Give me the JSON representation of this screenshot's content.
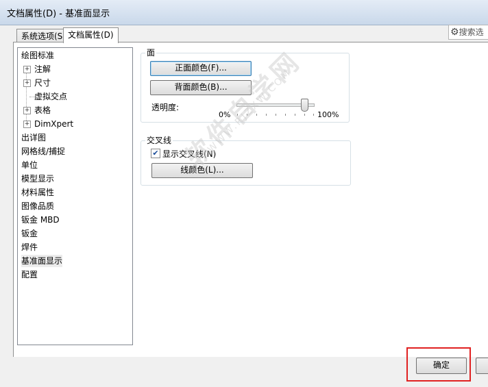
{
  "window": {
    "title": "文档属性(D) - 基准面显示"
  },
  "tabs": [
    {
      "label": "系统选项(S)"
    },
    {
      "label": "文档属性(D)"
    }
  ],
  "search": {
    "placeholder": "搜索选"
  },
  "tree": {
    "items": [
      {
        "label": "绘图标准",
        "expandable": false
      },
      {
        "label": "注解",
        "expandable": true
      },
      {
        "label": "尺寸",
        "expandable": true
      },
      {
        "label": "虚拟交点",
        "expandable": false
      },
      {
        "label": "表格",
        "expandable": true
      },
      {
        "label": "DimXpert",
        "expandable": true
      },
      {
        "label": "出详图",
        "expandable": false
      },
      {
        "label": "网格线/捕捉",
        "expandable": false
      },
      {
        "label": "单位",
        "expandable": false
      },
      {
        "label": "模型显示",
        "expandable": false
      },
      {
        "label": "材料属性",
        "expandable": false
      },
      {
        "label": "图像品质",
        "expandable": false
      },
      {
        "label": "钣金 MBD",
        "expandable": false
      },
      {
        "label": "钣金",
        "expandable": false
      },
      {
        "label": "焊件",
        "expandable": false
      },
      {
        "label": "基准面显示",
        "expandable": false,
        "selected": true
      },
      {
        "label": "配置",
        "expandable": false
      }
    ]
  },
  "face_group": {
    "legend": "面",
    "front_color_button": "正面颜色(F)...",
    "back_color_button": "背面颜色(B)...",
    "transparency_label": "透明度:",
    "min_label": "0%",
    "max_label": "100%",
    "transparency_value": 0.88
  },
  "intersection_group": {
    "legend": "交叉线",
    "show_checkbox_label": "显示交叉线(N)",
    "show_checked": true,
    "line_color_button": "线颜色(L)..."
  },
  "footer": {
    "ok_button": "确定"
  },
  "watermark": {
    "text": "软件自学网",
    "url": "WWW.RJZXW.COM"
  },
  "colors": {
    "highlight_box": "#e02020",
    "titlebar": "#c9d8ea"
  }
}
